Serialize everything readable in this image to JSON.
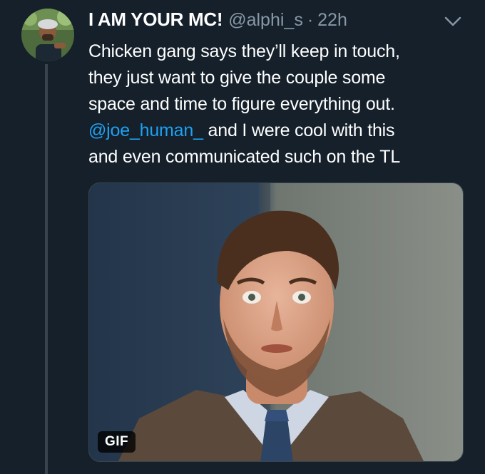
{
  "tweet": {
    "display_name": "I AM YOUR MC!",
    "handle": "@alphi_s",
    "separator": "·",
    "time": "22h",
    "text_lines": [
      "Chicken gang says they’ll keep in touch,",
      "they just want to give the couple some",
      "space and time to figure everything out."
    ],
    "mention": "@joe_human_",
    "text_after_mention": " and I were cool with this",
    "text_last_line": "and even communicated such on the TL",
    "media_badge": "GIF"
  },
  "colors": {
    "background": "#15202b",
    "text": "#ffffff",
    "secondary": "#8899a6",
    "link": "#1da1f2",
    "thread_line": "#38444d"
  },
  "icons": {
    "more_menu": "chevron-down-icon"
  }
}
